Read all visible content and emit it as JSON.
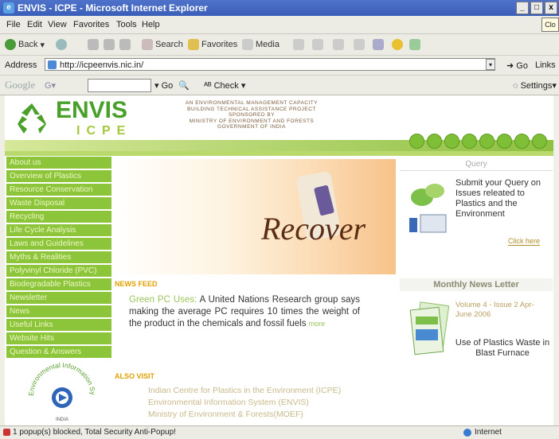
{
  "window": {
    "title": "ENVIS - ICPE - Microsoft Internet Explorer",
    "controls": [
      "_",
      "□",
      "x"
    ],
    "close_tooltip": "Clo"
  },
  "menu": [
    "File",
    "Edit",
    "View",
    "Favorites",
    "Tools",
    "Help"
  ],
  "toolbar": {
    "back": "Back",
    "search": "Search",
    "favorites": "Favorites",
    "media": "Media"
  },
  "address": {
    "label": "Address",
    "url": "http://icpeenvis.nic.in/",
    "go": "Go",
    "links": "Links"
  },
  "googlebar": {
    "logo": "Google",
    "go": "Go",
    "check": "Check",
    "settings": "Settings"
  },
  "site": {
    "logo_main": "ENVIS",
    "logo_sub": "ICPE",
    "subtitle_lines": [
      "AN ENVIRONMENTAL MANAGEMENT CAPACITY",
      "BUILDING TECHNICAL ASSISTANCE PROJECT",
      "SPONSORED BY",
      "MINISTRY OF ENVIRONMENT AND FORESTS",
      "GOVERNMENT OF INDIA"
    ],
    "nav_items": [
      "About us",
      "Overview of Plastics",
      "Resource Conservation",
      "Waste Disposal",
      "Recycling",
      "Life Cycle Analysis",
      "Laws and Guidelines",
      "Myths & Realities",
      "Polyvinyl Chloride (PVC)",
      "Biodegradable Plastics",
      "Newsletter",
      "News",
      "Useful Links",
      "Website Hits",
      "Question & Answers"
    ],
    "env_logo_text": "Environmental Information System",
    "env_logo_sub": "INDIA",
    "banner_word": "Recover",
    "news_feed_label": "NEWS FEED",
    "news_lead": "Green PC Uses:",
    "news_body": "A United Nations Research group says making the average PC requires 10 times the weight of the product in the chemicals and fossil fuels",
    "news_more": "more",
    "also_visit_label": "ALSO VISIT",
    "visit_links": [
      "Indian Centre for Plastics in the Environment (ICPE)",
      "Environmental Information System (ENVIS)",
      "Ministry of Environment & Forests(MOEF)"
    ],
    "query_head": "Query",
    "query_text": "Submit your Query on Issues releated to Plastics and the Environment",
    "query_click": "Click here",
    "newsletter_head": "Monthly News Letter",
    "newsletter_vol": "Volume 4 - Issue 2 Apr-June 2006",
    "newsletter_title": "Use of Plastics Waste in Blast Furnace"
  },
  "status": {
    "text": "1 popup(s) blocked, Total Security Anti-Popup!",
    "zone": "Internet"
  },
  "colors": {
    "brand_green": "#48a02a",
    "nav_green": "#8cc43a",
    "accent_gold": "#e0a000"
  }
}
